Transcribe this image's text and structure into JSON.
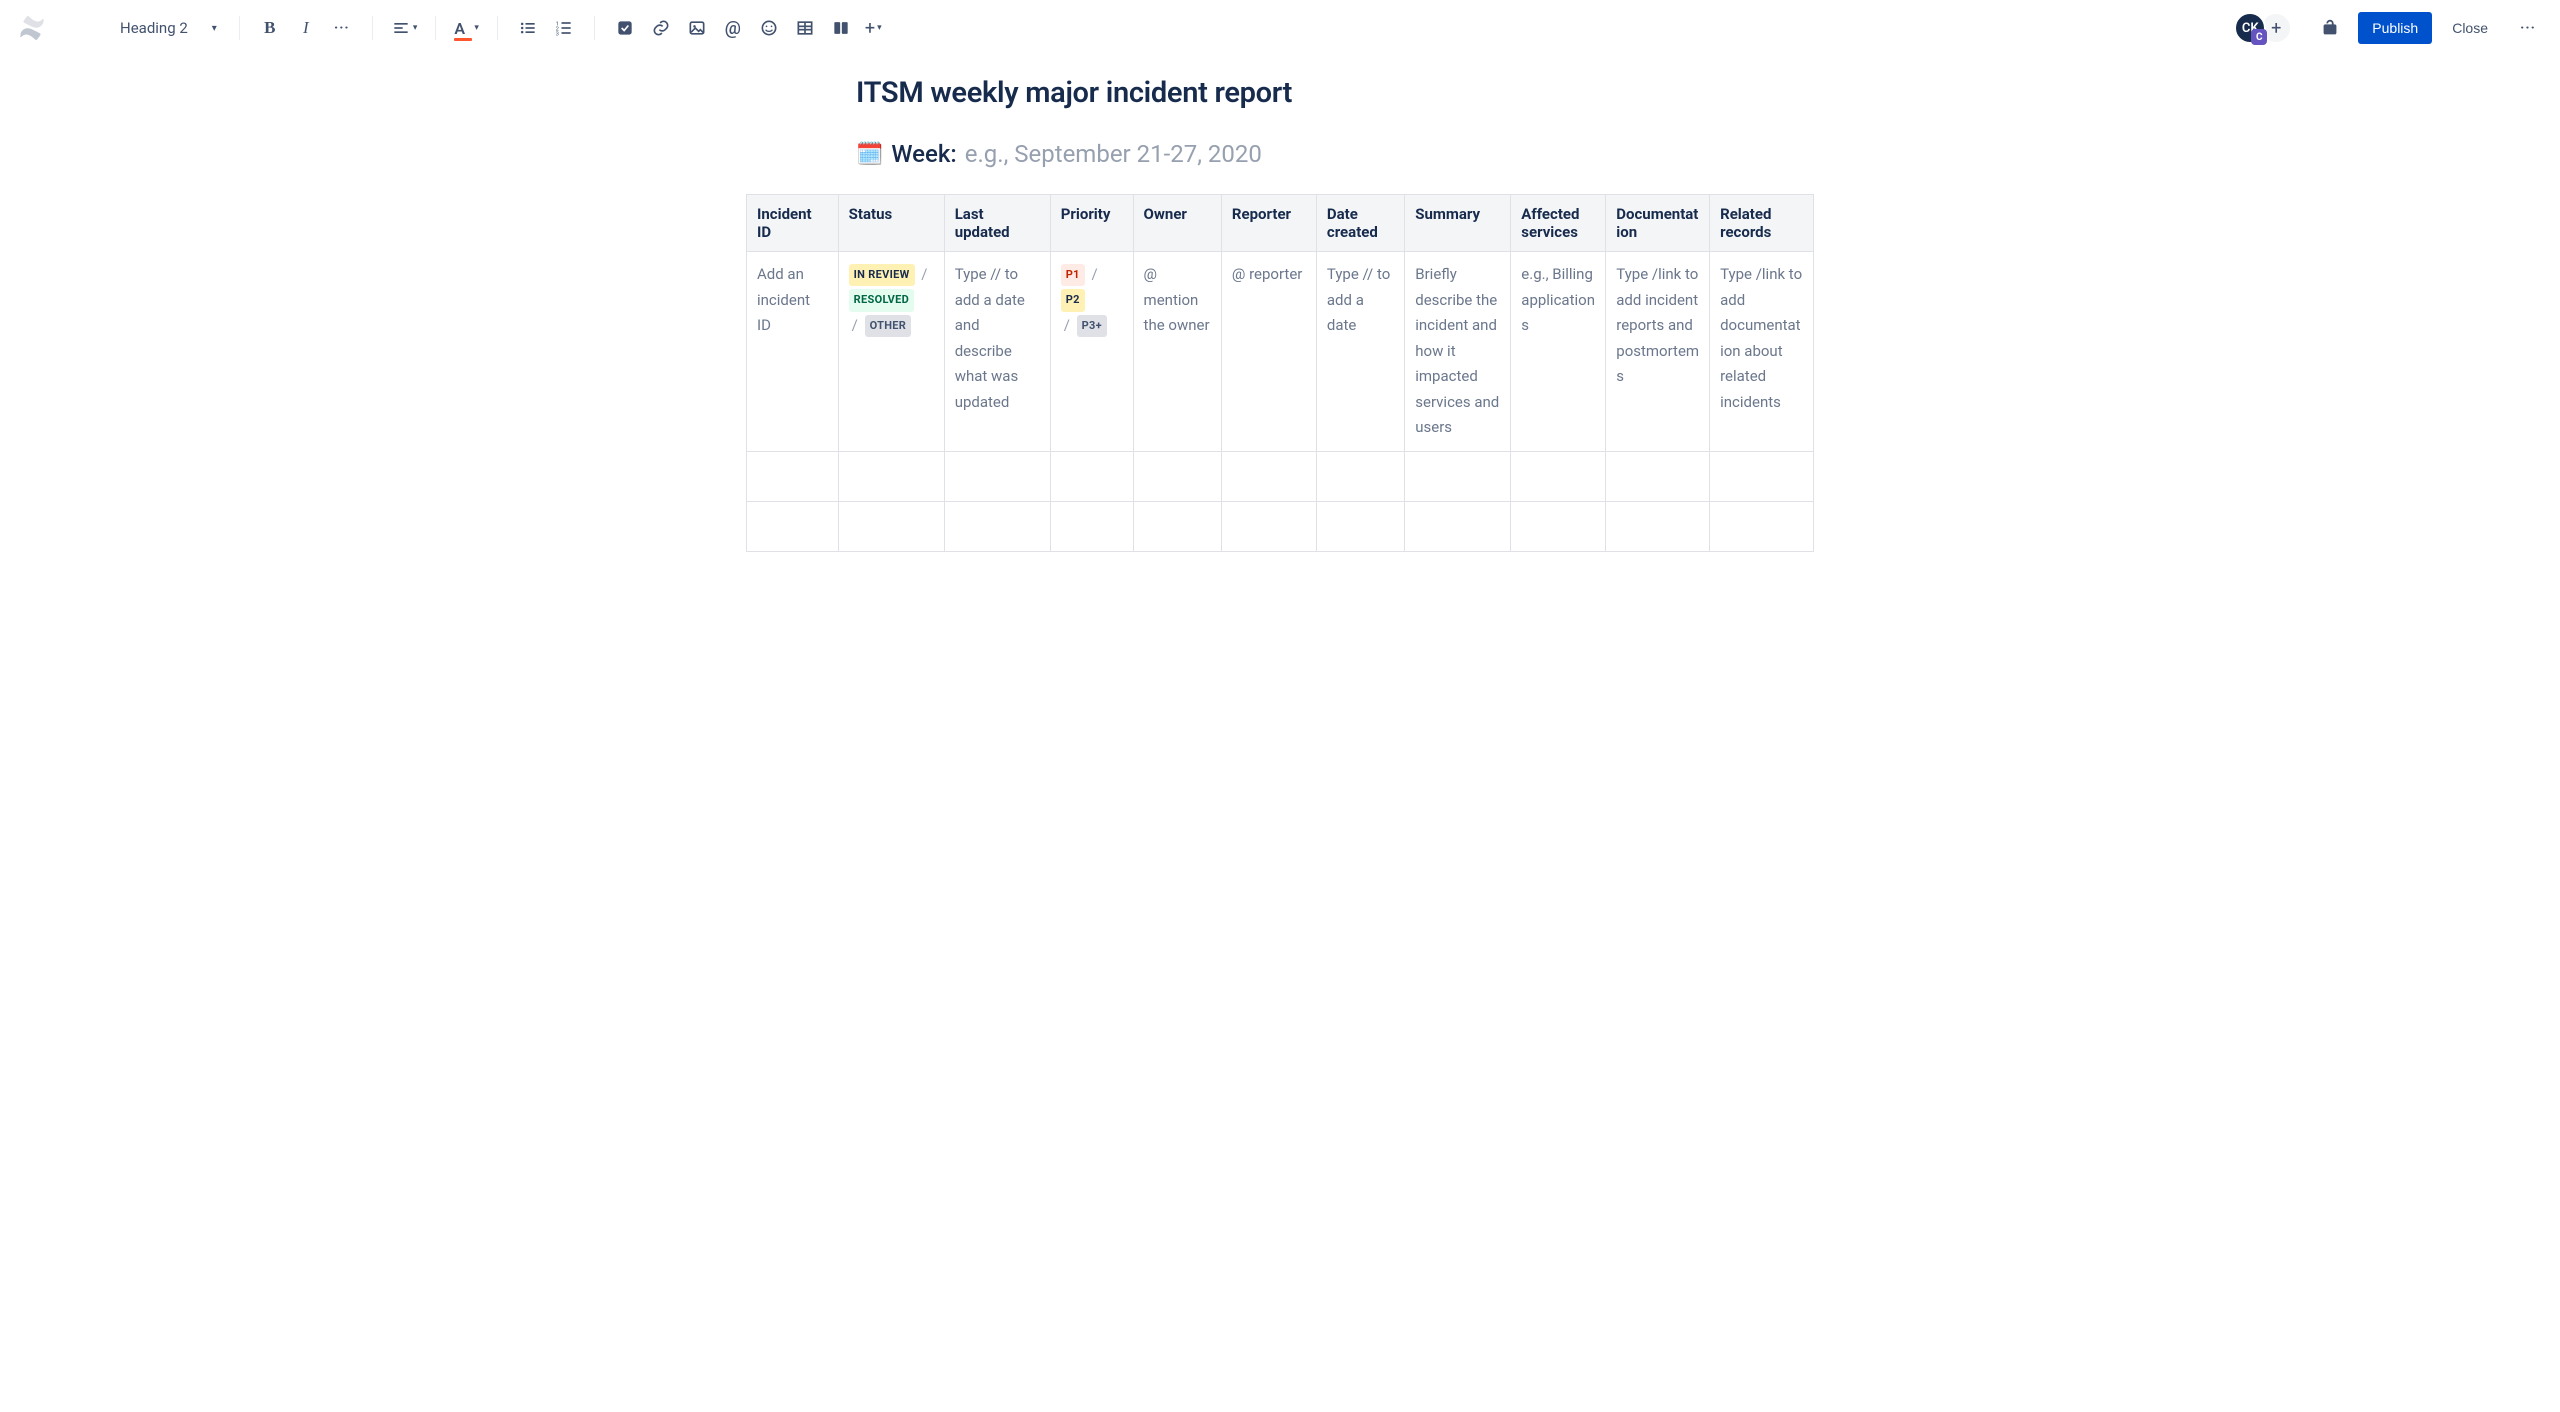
{
  "toolbar": {
    "text_style": "Heading 2",
    "avatar_initials": "CK",
    "avatar_badge": "C",
    "publish_label": "Publish",
    "close_label": "Close"
  },
  "page": {
    "title": "ITSM weekly major incident report",
    "week_label": "Week:",
    "week_placeholder": "e.g., September 21-27, 2020",
    "calendar_emoji": "📅"
  },
  "table": {
    "headers": [
      "Incident ID",
      "Status",
      "Last updated",
      "Priority",
      "Owner",
      "Reporter",
      "Date created",
      "Summary",
      "Affected services",
      "Documentation",
      "Related records"
    ],
    "row": {
      "incident_id": "Add an incident ID",
      "status": {
        "in_review": "IN REVIEW",
        "resolved": "RESOLVED",
        "other": "OTHER"
      },
      "last_updated": "Type // to add a date and describe what was updated",
      "priority": {
        "p1": "P1",
        "p2": "P2",
        "p3": "P3+"
      },
      "owner": "@ mention the owner",
      "reporter": "@ reporter",
      "date_created": "Type // to add a date",
      "summary": "Briefly describe the incident and how it impacted services and users",
      "affected_services": "e.g., Billing applications",
      "documentation": "Type /link to add incident reports and postmortems",
      "related_records": "Type /link to add documentation about related incidents"
    }
  }
}
